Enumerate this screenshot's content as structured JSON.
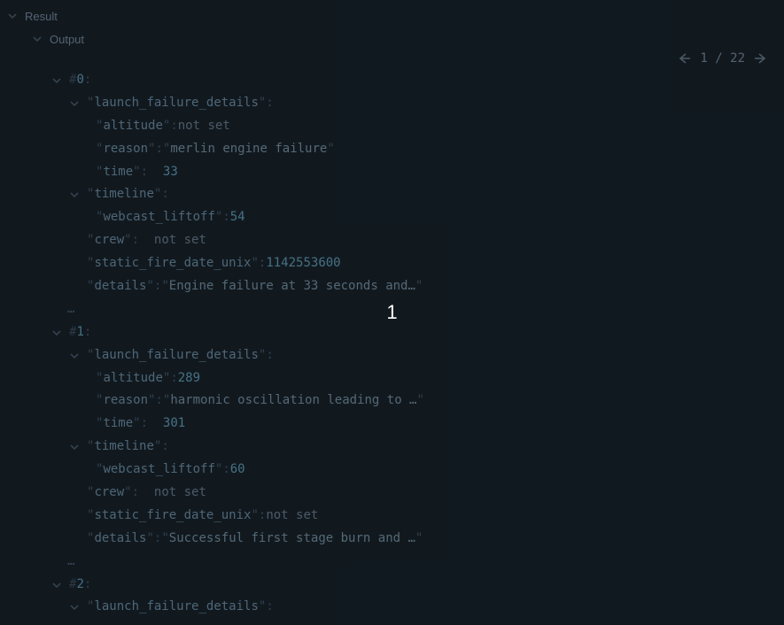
{
  "header": {
    "result_label": "Result",
    "output_label": "Output"
  },
  "pagination": {
    "current": "1",
    "separator": " / ",
    "total": "22"
  },
  "overlay_number": "1",
  "tree": {
    "items": [
      {
        "index": "0",
        "launch_failure_details": {
          "altitude": "not set",
          "reason": "merlin engine failure",
          "time": "33"
        },
        "timeline": {
          "webcast_liftoff": "54"
        },
        "crew": "not set",
        "static_fire_date_unix": "1142553600",
        "details": "Engine failure at 33 seconds and…"
      },
      {
        "index": "1",
        "launch_failure_details": {
          "altitude": "289",
          "reason": "harmonic oscillation leading to …",
          "time": "301"
        },
        "timeline": {
          "webcast_liftoff": "60"
        },
        "crew": "not set",
        "static_fire_date_unix": "not set",
        "details": "Successful first stage burn and …"
      },
      {
        "index": "2",
        "launch_failure_details_label": "launch_failure_details"
      }
    ]
  },
  "labels": {
    "launch_failure_details": "launch_failure_details",
    "altitude": "altitude",
    "reason": "reason",
    "time": "time",
    "timeline": "timeline",
    "webcast_liftoff": "webcast_liftoff",
    "crew": "crew",
    "static_fire_date_unix": "static_fire_date_unix",
    "details": "details",
    "ellipsis": "…"
  }
}
